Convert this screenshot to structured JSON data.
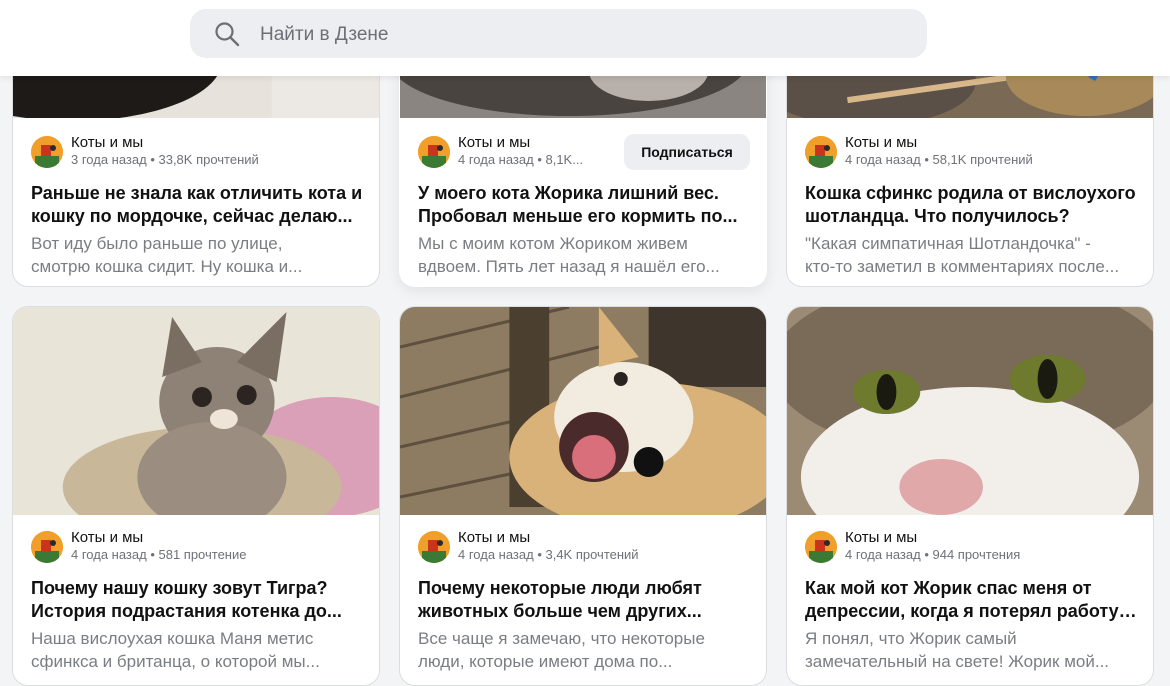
{
  "search": {
    "placeholder": "Найти в Дзене"
  },
  "subscribe_label": "Подписаться",
  "cards": [
    {
      "channel": "Коты и мы",
      "meta": "3 года назад • 33,8K прочтений",
      "title_1": "Раньше не знала как отличить кота и",
      "title_2": "кошку по мордочке, сейчас делаю...",
      "snippet_1": "Вот иду было раньше по улице,",
      "snippet_2": "смотрю кошка сидит. Ну кошка и..."
    },
    {
      "channel": "Коты и мы",
      "meta": "4 года назад • 8,1K...",
      "title_1": "У моего кота Жорика лишний вес.",
      "title_2": "Пробовал меньше его кормить по...",
      "snippet_1": "Мы с моим котом Жориком живем",
      "snippet_2": "вдвоем. Пять лет назад я нашёл его..."
    },
    {
      "channel": "Коты и мы",
      "meta": "4 года назад • 58,1K прочтений",
      "title_1": "Кошка сфинкс родила от вислоухого",
      "title_2": "шотландца. Что получилось?",
      "snippet_1": "\"Какая симпатичная Шотландочка\" -",
      "snippet_2": "кто-то заметил в комментариях после..."
    },
    {
      "channel": "Коты и мы",
      "meta": "4 года назад • 581 прочтение",
      "title_1": "Почему нашу кошку зовут Тигра?",
      "title_2": "История подрастания котенка до...",
      "snippet_1": "Наша вислоухая кошка Маня метис",
      "snippet_2": "сфинкса и британца, о которой мы..."
    },
    {
      "channel": "Коты и мы",
      "meta": "4 года назад • 3,4K прочтений",
      "title_1": "Почему некоторые люди любят",
      "title_2": "животных больше чем других...",
      "snippet_1": "Все чаще я замечаю, что некоторые",
      "snippet_2": "люди, которые имеют дома по..."
    },
    {
      "channel": "Коты и мы",
      "meta": "4 года назад • 944 прочтения",
      "title_1": "Как мой кот Жорик спас меня от",
      "title_2": "депрессии, когда я потерял работу ...",
      "snippet_1": "Я понял, что Жорик самый",
      "snippet_2": "замечательный на свете! Жорик мой..."
    }
  ]
}
